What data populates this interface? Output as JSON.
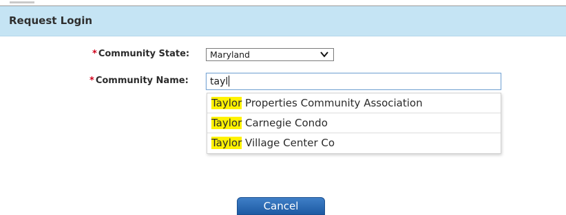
{
  "header": {
    "title": "Request Login"
  },
  "form": {
    "required_mark": "*",
    "state_label": "Community State:",
    "state_value": "Maryland",
    "name_label": "Community Name:",
    "name_value": "tayl"
  },
  "suggestions": [
    {
      "match": "Taylor",
      "rest": " Properties Community Association"
    },
    {
      "match": "Taylor",
      "rest": " Carnegie Condo"
    },
    {
      "match": "Taylor",
      "rest": " Village Center Co"
    }
  ],
  "buttons": {
    "cancel_label": "Cancel"
  },
  "colors": {
    "header_bg": "#c5e4f4",
    "highlight": "#fff200",
    "required": "#d0021b",
    "button": "#2a66b0"
  }
}
